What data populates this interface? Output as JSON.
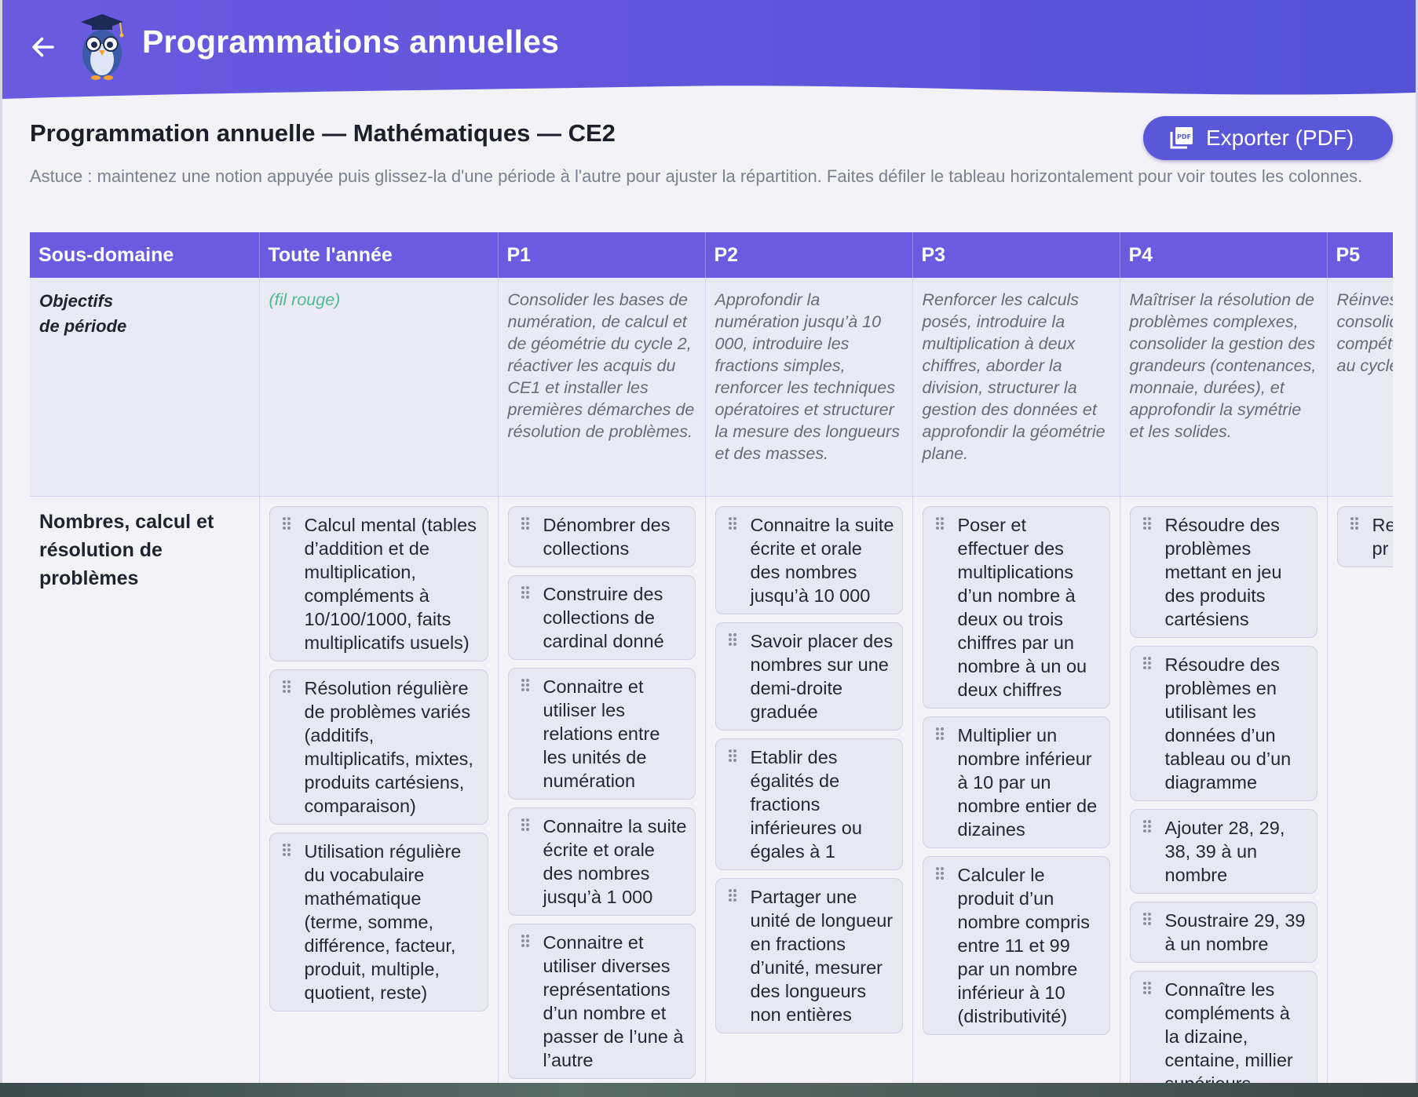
{
  "app": {
    "title": "Programmations annuelles",
    "back_icon": "arrow-left-icon",
    "mascot_icon": "owl-graduate-icon",
    "colors": {
      "header": "#5b57d9",
      "accent": "#6b5be0",
      "fil_rouge": "#4fb89a"
    }
  },
  "page": {
    "title": "Programmation annuelle — Mathématiques — CE2",
    "export_label": "Exporter (PDF)",
    "export_icon": "pdf-icon",
    "hint": "Astuce : maintenez une notion appuyée puis glissez-la d'une période à l'autre pour ajuster la répartition. Faites défiler le tableau horizontalement pour voir toutes les colonnes."
  },
  "table": {
    "headers": [
      "Sous-domaine",
      "Toute l'année",
      "P1",
      "P2",
      "P3",
      "P4",
      "P5"
    ],
    "objectives": {
      "label_line1": "Objectifs",
      "label_line2": "de période",
      "all_year": "(fil rouge)",
      "p1": "Consolider les bases de numération, de calcul et de géométrie du cycle 2, réactiver les acquis du CE1 et installer les premières démarches de résolution de problèmes.",
      "p2": "Approfondir la numération jusqu’à 10 000, introduire les fractions simples, renforcer les techniques opératoires et structurer la mesure des longueurs et des masses.",
      "p3": "Renforcer les calculs posés, introduire la multiplication à deux chiffres, aborder la division, structurer la gestion des données et approfondir la géométrie plane.",
      "p4": "Maîtriser la résolution de problèmes complexes, consolider la gestion des grandeurs (contenances, monnaie, durées), et approfondir la symétrie et les solides.",
      "p5": "Réinvestir des notions, consolider compétences cycle, pr au cycle situatio et des"
    },
    "domain": {
      "label": "Nombres, calcul et résolution de problèmes",
      "all_year": [
        "Calcul mental (tables d’addition et de multiplication, compléments à 10/100/1000, faits multiplicatifs usuels)",
        "Résolution régulière de problèmes variés (additifs, multiplicatifs, mixtes, produits cartésiens, comparaison)",
        "Utilisation régulière du vocabulaire mathématique (terme, somme, différence, facteur, produit, multiple, quotient, reste)"
      ],
      "p1": [
        "Dénombrer des collections",
        "Construire des collections de cardinal donné",
        "Connaitre et utiliser les relations entre les unités de numération",
        "Connaitre la suite écrite et orale des nombres jusqu’à 1 000",
        "Connaitre et utiliser diverses représentations d’un nombre et passer de l’une à l’autre"
      ],
      "p2": [
        "Connaitre la suite écrite et orale des nombres jusqu’à 10 000",
        "Savoir placer des nombres sur une demi-droite graduée",
        "Etablir des égalités de fractions inférieures ou égales à 1",
        "Partager une unité de longueur en fractions d’unité, mesurer des longueurs non entières"
      ],
      "p3": [
        "Poser et effectuer des multiplications d’un nombre à deux ou trois chiffres par un nombre à un ou deux chiffres",
        "Multiplier un nombre inférieur à 10 par un nombre entier de dizaines",
        "Calculer le produit d’un nombre compris entre 11 et 99 par un nombre inférieur à 10 (distributivité)"
      ],
      "p4": [
        "Résoudre des problèmes mettant en jeu des produits cartésiens",
        "Résoudre des problèmes en utilisant les données d’un tableau ou d’un diagramme",
        "Ajouter 28, 29, 38, 39 à un nombre",
        "Soustraire 29, 39 à un nombre",
        "Connaître les compléments à la dizaine, centaine, millier supérieurs"
      ],
      "p5": [
        "Re nt nu ca ré pr co pr cy"
      ]
    }
  }
}
